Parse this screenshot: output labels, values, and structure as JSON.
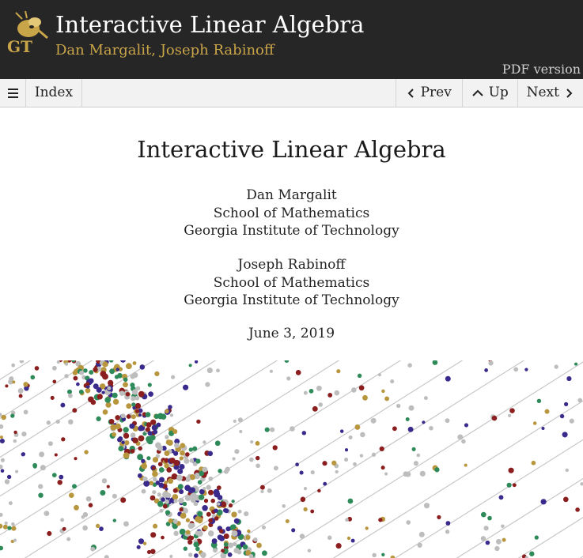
{
  "header": {
    "logo_icon": "gt-yellow-jacket-logo",
    "logo_text": "GT",
    "title": "Interactive Linear Algebra",
    "authors": "Dan Margalit, Joseph Rabinoff",
    "pdf_link": "PDF version"
  },
  "navbar": {
    "menu_icon": "hamburger-menu-icon",
    "index_label": "Index",
    "prev_label": "Prev",
    "up_label": "Up",
    "next_label": "Next"
  },
  "content": {
    "title": "Interactive Linear Algebra",
    "author1": {
      "name": "Dan Margalit",
      "department": "School of Mathematics",
      "institution": "Georgia Institute of Technology"
    },
    "author2": {
      "name": "Joseph Rabinoff",
      "department": "School of Mathematics",
      "institution": "Georgia Institute of Technology"
    },
    "date": "June 3, 2019"
  },
  "colors": {
    "header_bg": "#262626",
    "gold": "#c9a54a",
    "dot_colors": [
      "#8b1e1e",
      "#3a2a8c",
      "#2f8a5a",
      "#b8963e",
      "#bdbdbd"
    ]
  }
}
